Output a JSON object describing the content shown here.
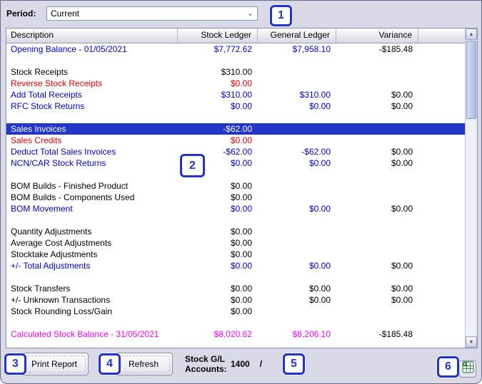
{
  "period": {
    "label": "Period:",
    "value": "Current"
  },
  "table": {
    "columns": [
      "Description",
      "Stock Ledger",
      "General Ledger",
      "Variance"
    ],
    "rows": [
      {
        "desc": "Opening Balance - 01/05/2021",
        "stock": "$7,772.62",
        "gl": "$7,958.10",
        "variance": "-$185.48",
        "color": "blue"
      },
      {
        "blank": true
      },
      {
        "desc": "Stock Receipts",
        "stock": "$310.00",
        "color": "black"
      },
      {
        "desc": "Reverse Stock Receipts",
        "stock": "$0.00",
        "color": "red"
      },
      {
        "desc": "Add Total Receipts",
        "stock": "$310.00",
        "gl": "$310.00",
        "variance": "$0.00",
        "color": "blue"
      },
      {
        "desc": "RFC Stock Returns",
        "stock": "$0.00",
        "gl": "$0.00",
        "variance": "$0.00",
        "color": "blue"
      },
      {
        "blank": true
      },
      {
        "desc": "Sales Invoices",
        "stock": "-$62.00",
        "color": "black",
        "selected": true
      },
      {
        "desc": "Sales Credits",
        "stock": "$0.00",
        "color": "red"
      },
      {
        "desc": "Deduct Total Sales Invoices",
        "stock": "-$62.00",
        "gl": "-$62.00",
        "variance": "$0.00",
        "color": "blue"
      },
      {
        "desc": "NCN/CAR Stock Returns",
        "stock": "$0.00",
        "gl": "$0.00",
        "variance": "$0.00",
        "color": "blue"
      },
      {
        "blank": true
      },
      {
        "desc": "BOM Builds - Finished Product",
        "stock": "$0.00",
        "color": "black"
      },
      {
        "desc": "BOM Builds - Components Used",
        "stock": "$0.00",
        "color": "black"
      },
      {
        "desc": "BOM Movement",
        "stock": "$0.00",
        "gl": "$0.00",
        "variance": "$0.00",
        "color": "blue"
      },
      {
        "blank": true
      },
      {
        "desc": "Quantity Adjustments",
        "stock": "$0.00",
        "color": "black"
      },
      {
        "desc": "Average Cost Adjustments",
        "stock": "$0.00",
        "color": "black"
      },
      {
        "desc": "Stocktake Adjustments",
        "stock": "$0.00",
        "color": "black"
      },
      {
        "desc": "+/- Total Adjustments",
        "stock": "$0.00",
        "gl": "$0.00",
        "variance": "$0.00",
        "color": "blue"
      },
      {
        "blank": true
      },
      {
        "desc": "Stock Transfers",
        "stock": "$0.00",
        "gl": "$0.00",
        "variance": "$0.00",
        "color": "black"
      },
      {
        "desc": "+/- Unknown Transactions",
        "stock": "$0.00",
        "gl": "$0.00",
        "variance": "$0.00",
        "color": "black"
      },
      {
        "desc": "Stock Rounding Loss/Gain",
        "stock": "$0.00",
        "color": "black"
      },
      {
        "blank": true
      },
      {
        "desc": "Calculated Stock Balance - 31/05/2021",
        "stock": "$8,020.62",
        "gl": "$8,206.10",
        "variance": "-$185.48",
        "color": "magenta"
      }
    ]
  },
  "footer": {
    "print_label": "Print Report",
    "refresh_label": "Refresh",
    "stock_gl_line1": "Stock G/L",
    "stock_gl_line2": "Accounts:",
    "stock_gl_value": "1400",
    "stock_gl_sep": "/",
    "excel_icon": "excel-export-icon"
  },
  "callouts": [
    "1",
    "2",
    "3",
    "4",
    "5",
    "6"
  ],
  "colors": {
    "chrome_bg": "#d9d9e8",
    "blue_text": "#0000cc",
    "red_text": "#e60000",
    "magenta_text": "#ff00ff",
    "black_text": "#000000",
    "selected_row_bg": "#2236c8",
    "selected_row_text": "#ffffff",
    "callout_accent": "#2233cc"
  }
}
